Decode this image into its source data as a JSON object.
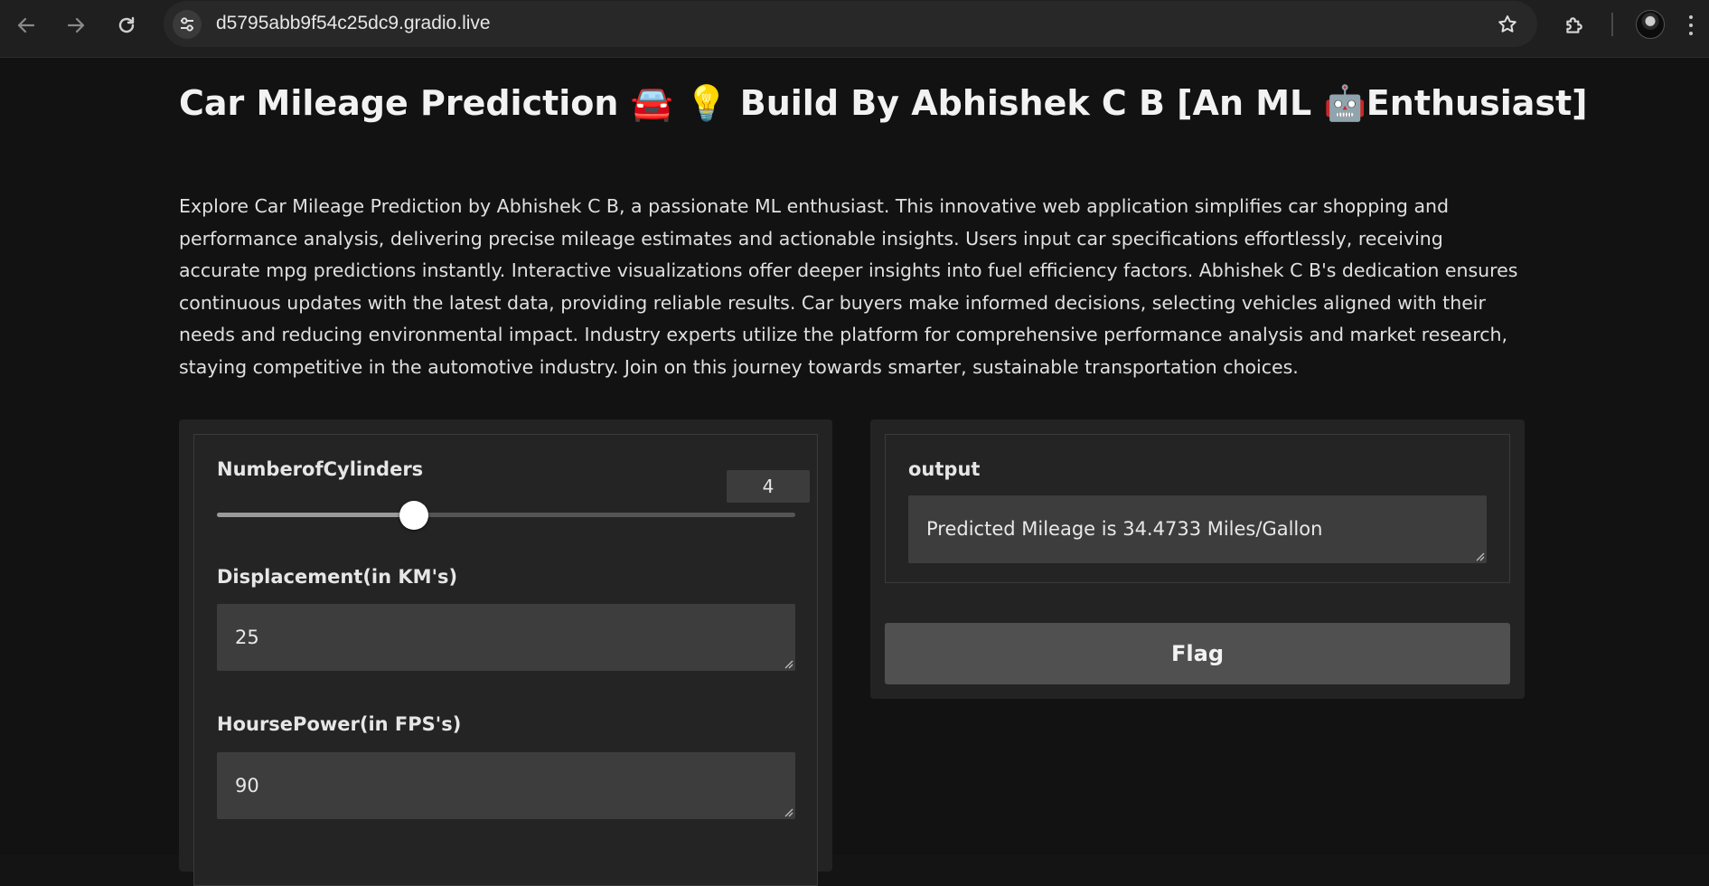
{
  "browser": {
    "url": "d5795abb9f54c25dc9.gradio.live"
  },
  "page": {
    "title": "Car Mileage Prediction 🚘 💡 Build By Abhishek C B [An ML 🤖Enthusiast]",
    "description": "Explore Car Mileage Prediction by Abhishek C B, a passionate ML enthusiast. This innovative web application simplifies car shopping and performance analysis, delivering precise mileage estimates and actionable insights. Users input car specifications effortlessly, receiving accurate mpg predictions instantly. Interactive visualizations offer deeper insights into fuel efficiency factors. Abhishek C B's dedication ensures continuous updates with the latest data, providing reliable results. Car buyers make informed decisions, selecting vehicles aligned with their needs and reducing environmental impact. Industry experts utilize the platform for comprehensive performance analysis and market research, staying competitive in the automotive industry. Join on this journey towards smarter, sustainable transportation choices."
  },
  "inputs": {
    "cylinders": {
      "label": "NumberofCylinders",
      "value": "4",
      "slider_fraction": 0.34
    },
    "displacement": {
      "label": "Displacement(in KM's)",
      "value": "25"
    },
    "horsepower": {
      "label": "HoursePower(in FPS's)",
      "value": "90"
    }
  },
  "outputs": {
    "label": "output",
    "value": "Predicted Mileage is 34.4733 Miles/Gallon",
    "flag_label": "Flag"
  },
  "icons": {
    "back": "arrow-left-icon",
    "forward": "arrow-right-icon",
    "reload": "reload-icon",
    "site_info": "tune-icon",
    "bookmark": "star-icon",
    "extensions": "puzzle-icon",
    "menu": "kebab-menu-icon"
  }
}
